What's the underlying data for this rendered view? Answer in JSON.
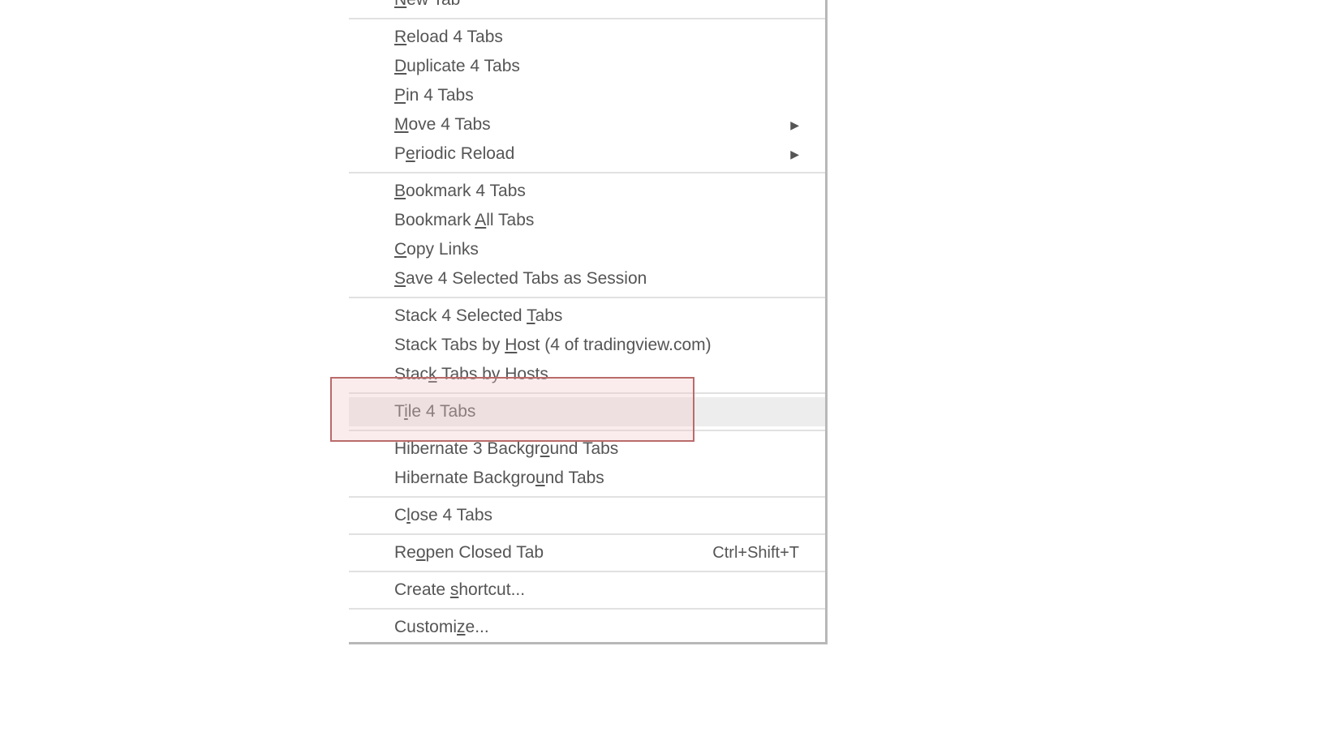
{
  "menu": {
    "items": [
      {
        "pre": "",
        "u": "N",
        "post": "ew Tab",
        "submenu": false,
        "shortcut": ""
      },
      {
        "sep": true
      },
      {
        "pre": "",
        "u": "R",
        "post": "eload 4 Tabs",
        "submenu": false,
        "shortcut": ""
      },
      {
        "pre": "",
        "u": "D",
        "post": "uplicate 4 Tabs",
        "submenu": false,
        "shortcut": ""
      },
      {
        "pre": "",
        "u": "P",
        "post": "in 4 Tabs",
        "submenu": false,
        "shortcut": ""
      },
      {
        "pre": "",
        "u": "M",
        "post": "ove 4 Tabs",
        "submenu": true,
        "shortcut": ""
      },
      {
        "pre": "P",
        "u": "e",
        "post": "riodic Reload",
        "submenu": true,
        "shortcut": ""
      },
      {
        "sep": true
      },
      {
        "pre": "",
        "u": "B",
        "post": "ookmark 4 Tabs",
        "submenu": false,
        "shortcut": ""
      },
      {
        "pre": "Bookmark ",
        "u": "A",
        "post": "ll Tabs",
        "submenu": false,
        "shortcut": ""
      },
      {
        "pre": "",
        "u": "C",
        "post": "opy Links",
        "submenu": false,
        "shortcut": ""
      },
      {
        "pre": "",
        "u": "S",
        "post": "ave 4 Selected Tabs as Session",
        "submenu": false,
        "shortcut": ""
      },
      {
        "sep": true
      },
      {
        "pre": "Stack 4 Selected ",
        "u": "T",
        "post": "abs",
        "submenu": false,
        "shortcut": ""
      },
      {
        "pre": "Stack Tabs by ",
        "u": "H",
        "post": "ost (4 of tradingview.com)",
        "submenu": false,
        "shortcut": ""
      },
      {
        "pre": "Stac",
        "u": "k",
        "post": " Tabs by Hosts",
        "submenu": false,
        "shortcut": ""
      },
      {
        "sep": true
      },
      {
        "pre": "T",
        "u": "i",
        "post": "le 4 Tabs",
        "submenu": false,
        "shortcut": "",
        "hovered": true
      },
      {
        "sep": true
      },
      {
        "pre": "Hibernate 3 Backgr",
        "u": "o",
        "post": "und Tabs",
        "submenu": false,
        "shortcut": ""
      },
      {
        "pre": "Hibernate Backgro",
        "u": "u",
        "post": "nd Tabs",
        "submenu": false,
        "shortcut": ""
      },
      {
        "sep": true
      },
      {
        "pre": "C",
        "u": "l",
        "post": "ose 4 Tabs",
        "submenu": false,
        "shortcut": ""
      },
      {
        "sep": true
      },
      {
        "pre": "Re",
        "u": "o",
        "post": "pen Closed Tab",
        "submenu": false,
        "shortcut": "Ctrl+Shift+T"
      },
      {
        "sep": true
      },
      {
        "pre": "Create ",
        "u": "s",
        "post": "hortcut...",
        "submenu": false,
        "shortcut": ""
      },
      {
        "sep": true
      },
      {
        "pre": "Customi",
        "u": "z",
        "post": "e...",
        "submenu": false,
        "shortcut": ""
      }
    ]
  }
}
